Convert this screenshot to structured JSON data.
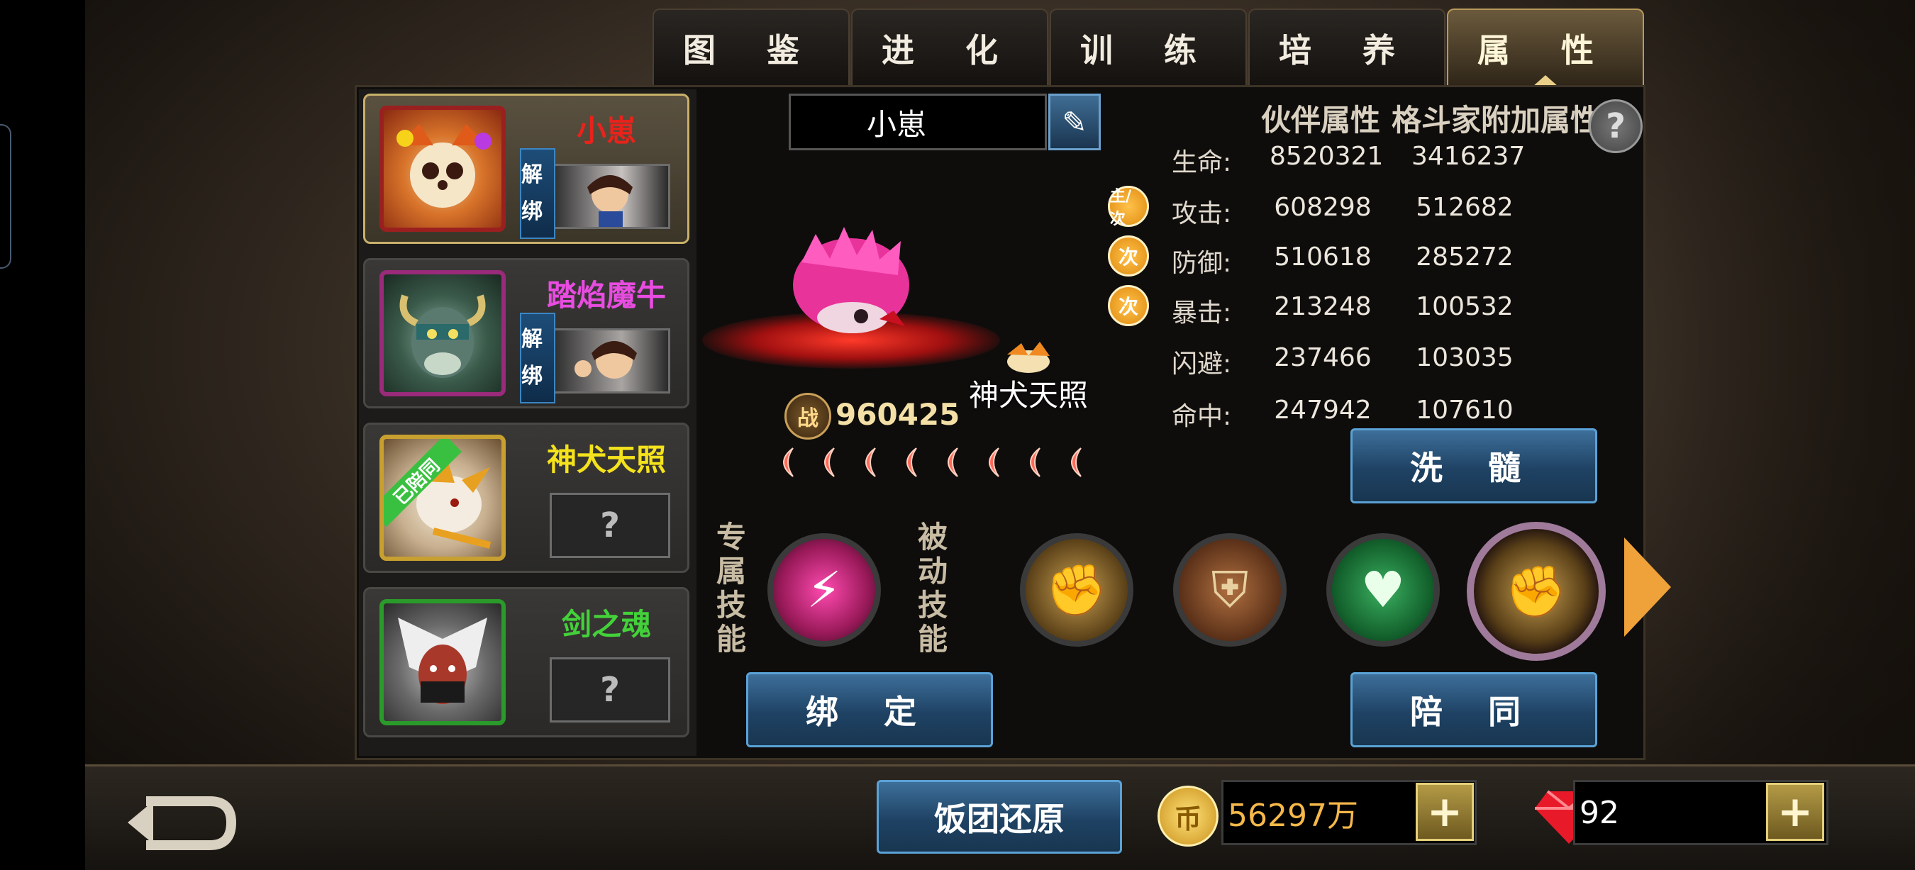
{
  "tabs": [
    {
      "label": "图 鉴",
      "active": false
    },
    {
      "label": "进 化",
      "active": false
    },
    {
      "label": "训 练",
      "active": false
    },
    {
      "label": "培 养",
      "active": false
    },
    {
      "label": "属 性",
      "active": true
    }
  ],
  "partners": [
    {
      "name": "小崽",
      "name_color": "#e8231c",
      "unbind": "解绑",
      "selected": true
    },
    {
      "name": "踏焰魔牛",
      "name_color": "#e84ce0",
      "unbind": "解绑",
      "selected": false
    },
    {
      "name": "神犬天照",
      "name_color": "#f4e21c",
      "tag": "已陪同",
      "slot": "?",
      "selected": false
    },
    {
      "name": "剑之魂",
      "name_color": "#43d13a",
      "slot": "?",
      "selected": false
    }
  ],
  "showcase": {
    "name": "小崽",
    "companion": "神犬天照",
    "power_icon": "战",
    "power": "960425",
    "stars": 8
  },
  "attributes": {
    "header_partner": "伙伴属性",
    "header_fighter": "格斗家附加属性",
    "help": "?",
    "rows": [
      {
        "label": "生命:",
        "partner": "8520321",
        "fighter": "3416237",
        "badge": ""
      },
      {
        "label": "攻击:",
        "partner": "608298",
        "fighter": "512682",
        "badge": "主/次"
      },
      {
        "label": "防御:",
        "partner": "510618",
        "fighter": "285272",
        "badge": "次"
      },
      {
        "label": "暴击:",
        "partner": "213248",
        "fighter": "100532",
        "badge": "次"
      },
      {
        "label": "闪避:",
        "partner": "237466",
        "fighter": "103035",
        "badge": ""
      },
      {
        "label": "命中:",
        "partner": "247942",
        "fighter": "107610",
        "badge": ""
      }
    ]
  },
  "buttons": {
    "refine": "洗 髓",
    "bind": "绑 定",
    "accompany": "陪 同",
    "restore": "饭团还原"
  },
  "skills": {
    "exclusive_label": "专属技能",
    "passive_label": "被动技能",
    "exclusive": [
      {
        "icon": "pink-slash-icon"
      }
    ],
    "passive": [
      {
        "icon": "fist-icon"
      },
      {
        "icon": "shield-icon"
      },
      {
        "icon": "heart-plus-icon"
      },
      {
        "icon": "fist-icon",
        "highlight": true
      }
    ]
  },
  "resources": {
    "gold": "56297万",
    "gems": "92",
    "plus": "+"
  }
}
